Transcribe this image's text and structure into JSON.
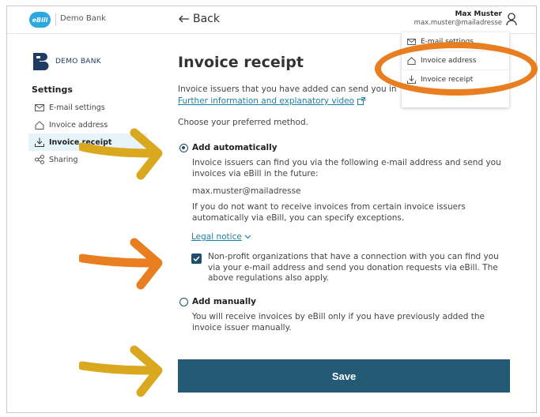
{
  "header": {
    "logo_text": "eBill",
    "bank_name": "Demo Bank",
    "back_label": "Back",
    "user_name": "Max Muster",
    "user_email": "max.muster@mailadresse"
  },
  "dropdown": {
    "items": [
      {
        "label": "E-mail settings",
        "icon": "envelope-icon"
      },
      {
        "label": "Invoice address",
        "icon": "home-icon"
      },
      {
        "label": "Invoice receipt",
        "icon": "inbox-download-icon"
      }
    ]
  },
  "sidebar": {
    "bank_logo_text": "DEMO BANK",
    "settings_title": "Settings",
    "items": [
      {
        "label": "E-mail settings",
        "icon": "envelope-icon",
        "active": false
      },
      {
        "label": "Invoice address",
        "icon": "home-icon",
        "active": false
      },
      {
        "label": "Invoice receipt",
        "icon": "inbox-download-icon",
        "active": true
      },
      {
        "label": "Sharing",
        "icon": "share-icon",
        "active": false
      }
    ]
  },
  "main": {
    "title": "Invoice receipt",
    "intro": "Invoice issuers that you have added can send you in",
    "info_link": "Further information and explanatory video",
    "choose": "Choose your preferred method.",
    "option_auto": {
      "label": "Add automatically",
      "selected": true,
      "desc": "Invoice issuers can find you via the following e-mail address and send you invoices via eBill in the future:",
      "email": "max.muster@mailadresse",
      "exceptions": "If you do not want to receive invoices from certain invoice issuers automatically via eBill, you can specify exceptions.",
      "legal_notice": "Legal notice",
      "nonprofit_checked": true,
      "nonprofit_text": "Non-profit organizations that have a connection with you can find you via your e-mail address and send you donation requests via eBill. The above regulations also apply."
    },
    "option_manual": {
      "label": "Add manually",
      "selected": false,
      "desc": "You will receive invoices by eBill only if you have previously added the invoice issuer manually."
    },
    "save_label": "Save"
  },
  "colors": {
    "accent": "#245b74",
    "link": "#1d7fa3",
    "ebill_blue": "#2aa8e0",
    "annotation_yellow": "#d9a81e",
    "annotation_orange": "#e87e1f"
  }
}
